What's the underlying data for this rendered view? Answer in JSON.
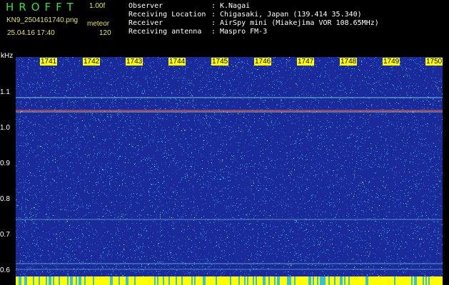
{
  "header": {
    "app_title": "HROFFT",
    "version": "1.00f",
    "filename": "KN9_2504161740.png",
    "mode": "meteor",
    "timestamp": "25.04.16 17:40",
    "count": "120",
    "meta": [
      {
        "key": "Observer",
        "value": "K.Nagai"
      },
      {
        "key": "Receiving Location",
        "value": "Chigasaki, Japan (139.414 35.340)"
      },
      {
        "key": "Receiver",
        "value": "AirSpy mini (Miakejima VOR 108.65MHz)"
      },
      {
        "key": "Receiving antenna",
        "value": "Maspro FM-3"
      }
    ]
  },
  "spectrogram": {
    "y_unit": "kHz",
    "y_ticks": [
      "1.1",
      "1.0",
      "0.9",
      "0.8",
      "0.7",
      "0.6"
    ],
    "x_ticks": [
      "1741",
      "1742",
      "1743",
      "1744",
      "1745",
      "1746",
      "1747",
      "1748",
      "1749",
      "1750"
    ],
    "background_color": "#1a2a9a",
    "noise_colors": [
      "#2f6fd8",
      "#37c0d8",
      "#3ee08a",
      "#ffffff"
    ],
    "carrier_color": "#ff5050",
    "bottom_band_color": "#ffff00"
  }
}
